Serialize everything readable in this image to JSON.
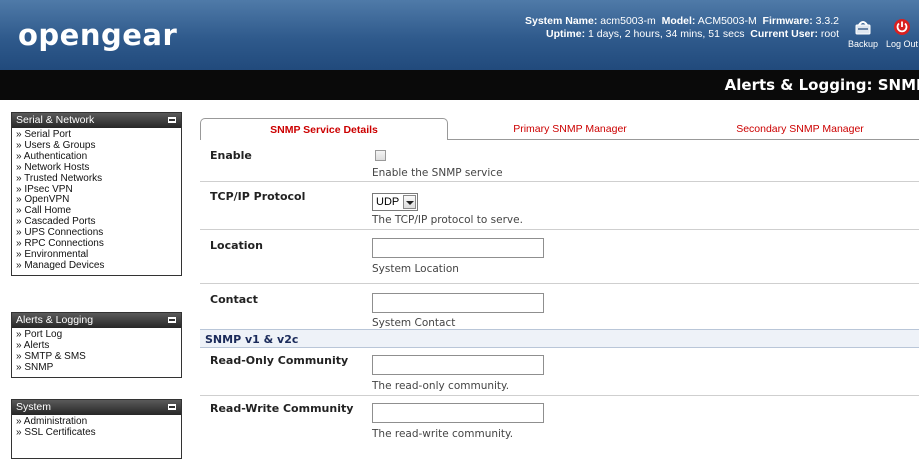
{
  "header": {
    "logo": "opengear",
    "system_name_label": "System Name:",
    "system_name": "acm5003-m",
    "model_label": "Model:",
    "model": "ACM5003-M",
    "firmware_label": "Firmware:",
    "firmware": "3.3.2",
    "uptime_label": "Uptime:",
    "uptime": "1 days, 2 hours, 34 mins, 51 secs",
    "current_user_label": "Current User:",
    "current_user": "root",
    "backup_label": "Backup",
    "logout_label": "Log Out"
  },
  "page_title": "Alerts & Logging: SNMP",
  "sidebar": {
    "serial_network": {
      "title": "Serial & Network",
      "items": [
        "Serial Port",
        "Users & Groups",
        "Authentication",
        "Network Hosts",
        "Trusted Networks",
        "IPsec VPN",
        "OpenVPN",
        "Call Home",
        "Cascaded Ports",
        "UPS Connections",
        "RPC Connections",
        "Environmental",
        "Managed Devices"
      ]
    },
    "alerts_logging": {
      "title": "Alerts & Logging",
      "items": [
        "Port Log",
        "Alerts",
        "SMTP & SMS",
        "SNMP"
      ]
    },
    "system": {
      "title": "System",
      "items": [
        "Administration",
        "SSL Certificates"
      ]
    }
  },
  "tabs": [
    "SNMP Service Details",
    "Primary SNMP Manager",
    "Secondary SNMP Manager"
  ],
  "form": {
    "enable": {
      "label": "Enable",
      "hint": "Enable the SNMP service",
      "checked": false
    },
    "protocol": {
      "label": "TCP/IP Protocol",
      "value": "UDP",
      "hint": "The TCP/IP protocol to serve."
    },
    "location": {
      "label": "Location",
      "value": "",
      "hint": "System Location"
    },
    "contact": {
      "label": "Contact",
      "value": "",
      "hint": "System Contact"
    },
    "section_v1v2c": "SNMP v1 & v2c",
    "ro_community": {
      "label": "Read-Only Community",
      "value": "",
      "hint": "The read-only community."
    },
    "rw_community": {
      "label": "Read-Write Community",
      "value": "",
      "hint": "The read-write community."
    }
  },
  "colors": {
    "header_blue": "#2f5a8c",
    "tab_red": "#cc0000",
    "title_bar": "#0a0a0a"
  }
}
